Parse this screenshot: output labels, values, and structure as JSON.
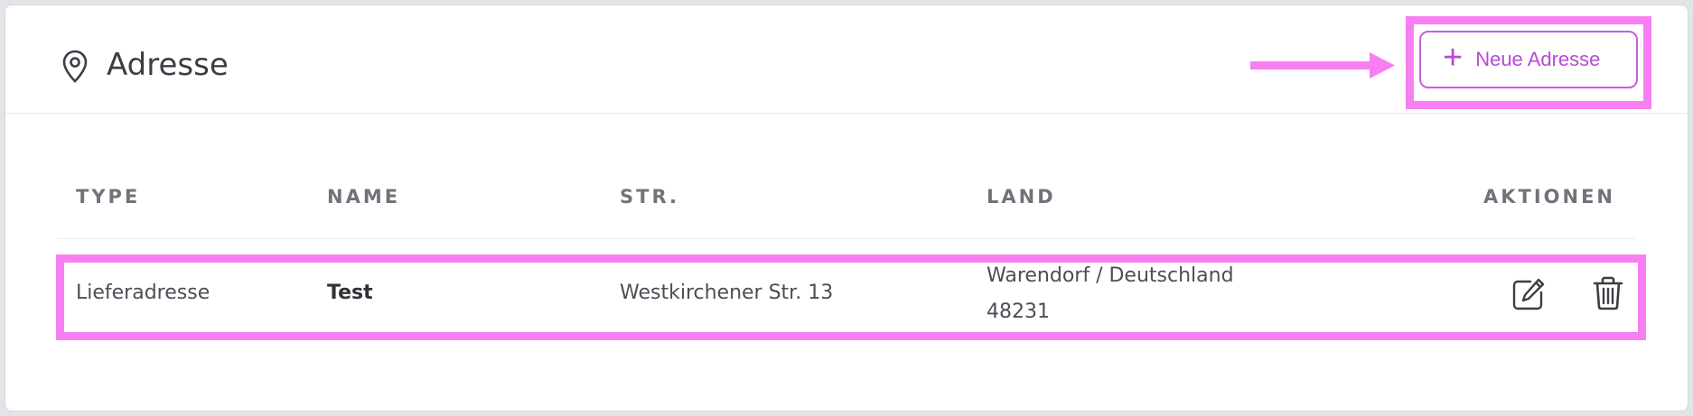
{
  "header": {
    "title": "Adresse",
    "icon": "map-pin-icon",
    "add_button_label": "Neue Adresse",
    "add_button_icon": "plus-icon"
  },
  "table": {
    "columns": [
      "TYPE",
      "NAME",
      "STR.",
      "LAND",
      "AKTIONEN"
    ],
    "rows": [
      {
        "type": "Lieferadresse",
        "name": "Test",
        "street": "Westkirchener Str. 13",
        "land": "Warendorf / Deutschland",
        "zip": "48231",
        "actions": [
          "edit-icon",
          "trash-icon"
        ]
      }
    ]
  },
  "colors": {
    "highlight": "#f77ff2",
    "accent": "#b949d4",
    "text": "#3a3f45",
    "header_text": "#6f747a"
  }
}
